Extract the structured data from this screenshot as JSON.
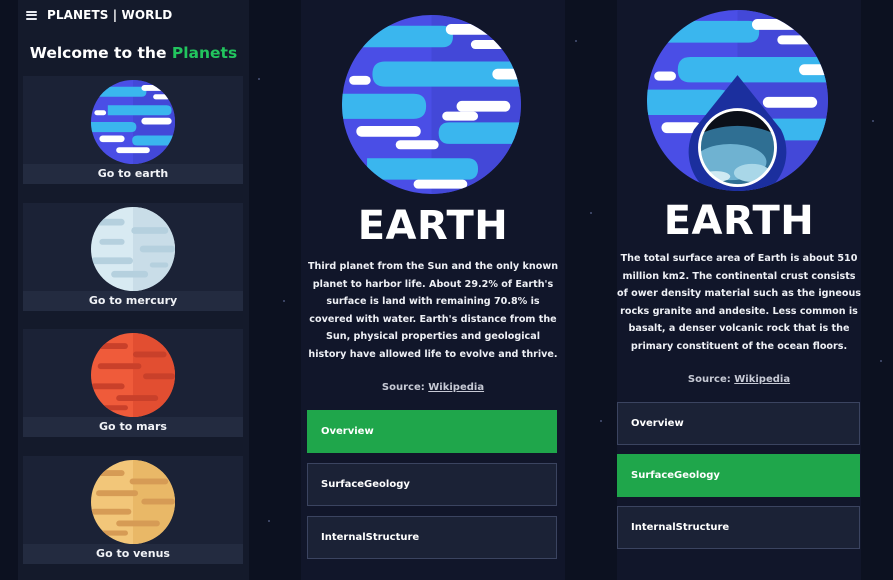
{
  "app": {
    "brand": "PLANETS | WORLD"
  },
  "sidebar": {
    "welcome_prefix": "Welcome to the",
    "welcome_accent": "Planets",
    "items": [
      {
        "label": "Go to earth"
      },
      {
        "label": "Go to mercury"
      },
      {
        "label": "Go to mars"
      },
      {
        "label": "Go to venus"
      }
    ]
  },
  "overview": {
    "title": "EARTH",
    "description": "Third planet from the Sun and the only known planet to harbor life. About 29.2% of Earth's surface is land with remaining 70.8% is covered with water. Earth's distance from the Sun, physical properties and geological history have allowed life to evolve and thrive.",
    "source_label": "Source:",
    "source_link": "Wikipedia",
    "tabs": [
      {
        "label": "Overview",
        "active": true
      },
      {
        "label": "SurfaceGeology",
        "active": false
      },
      {
        "label": "InternalStructure",
        "active": false
      }
    ]
  },
  "geology": {
    "title": "EARTH",
    "description": "The total surface area of Earth is about 510 million km2. The continental crust consists of ower density material such as the igneous rocks granite and andesite. Less common is basalt, a denser volcanic rock that is the primary constituent of the ocean floors.",
    "source_label": "Source:",
    "source_link": "Wikipedia",
    "tabs": [
      {
        "label": "Overview",
        "active": false
      },
      {
        "label": "SurfaceGeology",
        "active": true
      },
      {
        "label": "InternalStructure",
        "active": false
      }
    ]
  },
  "colors": {
    "background": "#0c1120",
    "panel": "#141a2b",
    "accent_green": "#1fa64b",
    "earth_blue": "#4b4fe3",
    "earth_cyan": "#3db8ee"
  }
}
